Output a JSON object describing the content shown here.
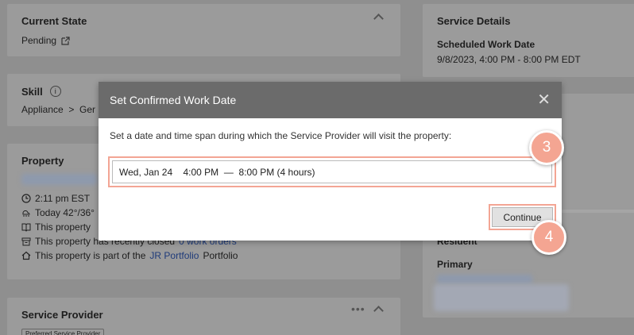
{
  "current_state": {
    "title": "Current State",
    "value": "Pending"
  },
  "skill": {
    "title": "Skill",
    "value": "Appliance  >  Ger"
  },
  "property": {
    "title": "Property",
    "time": "2:11 pm EST",
    "weather": "Today 42°/36°",
    "line3": "This property",
    "work_orders_prefix": "This property has recently closed",
    "work_orders_link": "0 work orders",
    "portfolio_prefix": "This property is part of the",
    "portfolio_link": "JR Portfolio",
    "portfolio_suffix": "Portfolio"
  },
  "service_provider": {
    "title": "Service Provider",
    "badge": "Preferred Service Provider"
  },
  "service_details": {
    "title": "Service Details",
    "sched_label": "Scheduled Work Date",
    "sched_value": "9/8/2023, 4:00 PM - 8:00 PM EDT"
  },
  "resident": {
    "label": "Resident",
    "primary": "Primary"
  },
  "modal": {
    "title": "Set Confirmed Work Date",
    "description": "Set a date and time span during which the Service Provider will visit the property:",
    "date_value": "Wed, Jan 24    4:00 PM  —  8:00 PM (4 hours)",
    "continue_label": "Continue",
    "close_glyph": "✕"
  },
  "steps": {
    "date_step": "3",
    "continue_step": "4"
  },
  "colors": {
    "accent": "#f4a592",
    "link": "#1f3b7a",
    "modal_header": "#6b6b6b"
  }
}
